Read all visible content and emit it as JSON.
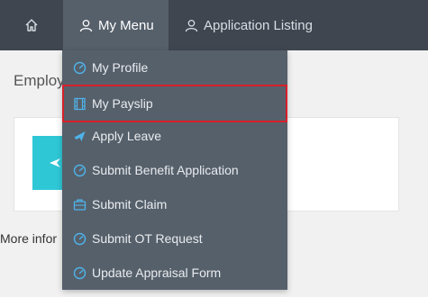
{
  "nav": {
    "home_icon": "home-icon",
    "my_menu_label": "My Menu",
    "application_listing_label": "Application Listing"
  },
  "page": {
    "heading": "Employ",
    "more_info": "More infor"
  },
  "menu": {
    "items": [
      {
        "label": "My Profile",
        "icon": "gauge-icon"
      },
      {
        "label": "My Payslip",
        "icon": "film-icon"
      },
      {
        "label": "Apply Leave",
        "icon": "plane-icon"
      },
      {
        "label": "Submit Benefit Application",
        "icon": "gauge-icon"
      },
      {
        "label": "Submit Claim",
        "icon": "briefcase-icon"
      },
      {
        "label": "Submit OT Request",
        "icon": "gauge-icon"
      },
      {
        "label": "Update Appraisal Form",
        "icon": "gauge-icon"
      }
    ]
  },
  "colors": {
    "nav_bg": "#3f4650",
    "menu_bg": "#56606b",
    "icon_accent": "#4fb3e8",
    "highlight_border": "#d6202b",
    "tile": "#2ec7d6"
  }
}
